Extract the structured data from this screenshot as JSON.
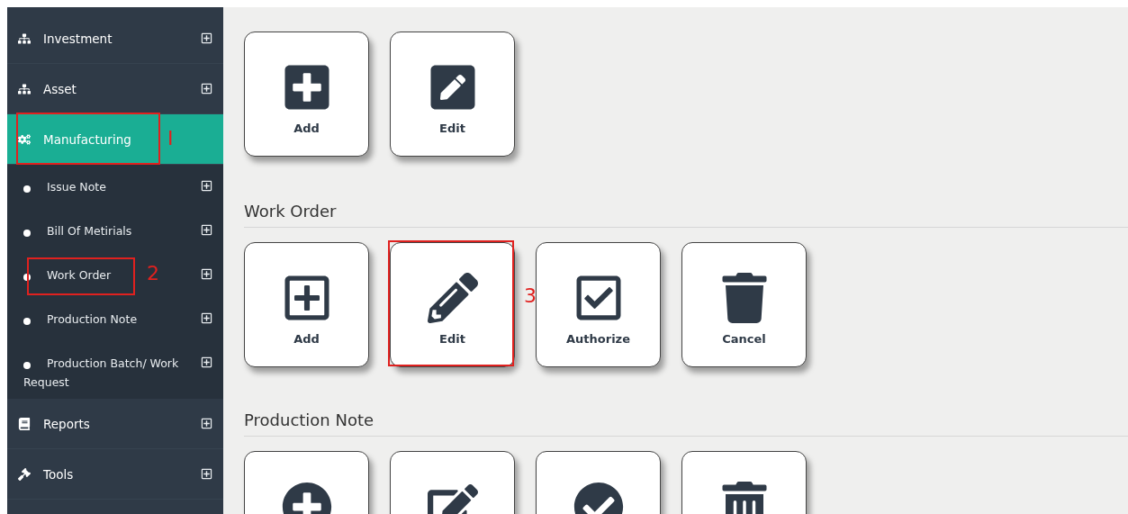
{
  "sidebar": {
    "items": [
      {
        "label": "Investment",
        "selected": false,
        "expanded": false
      },
      {
        "label": "Asset",
        "selected": false,
        "expanded": false
      },
      {
        "label": "Manufacturing",
        "selected": true,
        "expanded": true,
        "annotation": "I",
        "children": [
          {
            "label": "Issue Note",
            "expanded": false
          },
          {
            "label": "Bill Of Metirials",
            "expanded": false
          },
          {
            "label": "Work Order",
            "expanded": false,
            "annotation": "2"
          },
          {
            "label": "Production Note",
            "expanded": false
          },
          {
            "label": "Production Batch/ Work Request",
            "expanded": false
          }
        ]
      },
      {
        "label": "Reports",
        "selected": false,
        "expanded": false
      },
      {
        "label": "Tools",
        "selected": false,
        "expanded": false
      }
    ]
  },
  "sections": [
    {
      "tiles": [
        {
          "kind": "add",
          "label": "Add"
        },
        {
          "kind": "edit",
          "label": "Edit"
        }
      ]
    },
    {
      "heading": "Work Order",
      "tiles": [
        {
          "kind": "add",
          "label": "Add"
        },
        {
          "kind": "edit",
          "label": "Edit",
          "annotation": "3"
        },
        {
          "kind": "authorize",
          "label": "Authorize"
        },
        {
          "kind": "cancel",
          "label": "Cancel"
        }
      ]
    },
    {
      "heading": "Production Note",
      "tiles": [
        {
          "kind": "add"
        },
        {
          "kind": "edit"
        },
        {
          "kind": "authorize"
        },
        {
          "kind": "cancel"
        }
      ]
    }
  ]
}
